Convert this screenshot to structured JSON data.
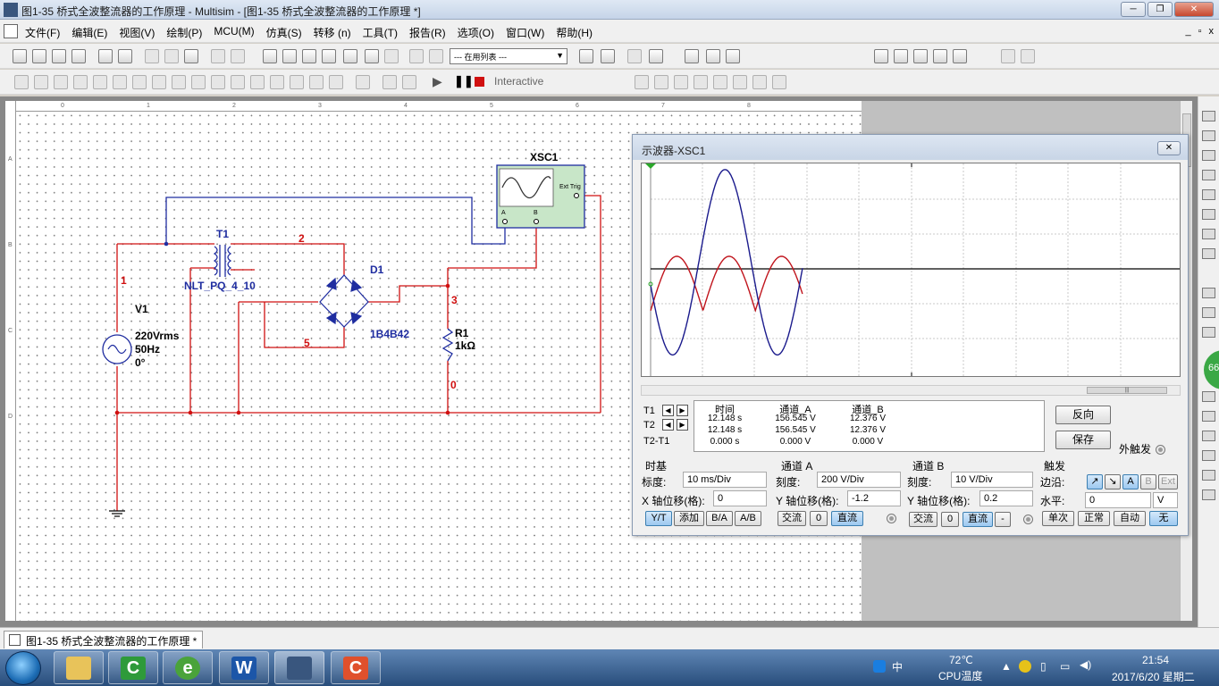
{
  "window": {
    "title": "图1-35  桥式全波整流器的工作原理 - Multisim - [图1-35  桥式全波整流器的工作原理 *]"
  },
  "window_buttons": {
    "minimize": "─",
    "maximize": "❐",
    "close": "✕"
  },
  "menu": [
    "文件(F)",
    "编辑(E)",
    "视图(V)",
    "绘制(P)",
    "MCU(M)",
    "仿真(S)",
    "转移 (n)",
    "工具(T)",
    "报告(R)",
    "选项(O)",
    "窗口(W)",
    "帮助(H)"
  ],
  "mdi_buttons": [
    "_",
    "▫",
    "x"
  ],
  "toolbar": {
    "in_use_list": "--- 在用列表 ---",
    "interactive": "Interactive"
  },
  "rulers": {
    "top": [
      "0",
      "1",
      "2",
      "3",
      "4",
      "5",
      "6",
      "7",
      "8"
    ],
    "left": [
      "A",
      "B",
      "C",
      "D"
    ]
  },
  "circuit": {
    "labels": {
      "xsc1": "XSC1",
      "t1": "T1",
      "t1_model": "NLT_PQ_4_10",
      "d1": "D1",
      "d1_model": "1B4B42",
      "v1": "V1",
      "v1_voltage": "220Vrms",
      "v1_freq": "50Hz",
      "v1_phase": "0°",
      "r1": "R1",
      "r1_value": "1kΩ",
      "net_1": "1",
      "net_2": "2",
      "net_3": "3",
      "net_5": "5",
      "net_0": "0",
      "ext_trig": "Ext Trig",
      "ch_a": "A",
      "ch_b": "B"
    },
    "colors": {
      "wire_red": "#d01010",
      "wire_blue": "#1f2da0",
      "component_blue": "#1f2da0",
      "scope_fill": "#c8e6c8"
    }
  },
  "oscilloscope": {
    "title": "示波器-XSC1",
    "close": "✕",
    "traces": {
      "channel_a_color": "#c0141c",
      "channel_b_color": "#1a1a8c"
    },
    "readout": {
      "headers": [
        "时间",
        "通道_A",
        "通道_B"
      ],
      "rows": [
        {
          "label": "T1",
          "time": "12.148 s",
          "a": "156.545 V",
          "b": "12.376 V"
        },
        {
          "label": "T2",
          "time": "12.148 s",
          "a": "156.545 V",
          "b": "12.376 V"
        },
        {
          "label": "T2-T1",
          "time": "0.000 s",
          "a": "0.000 V",
          "b": "0.000 V"
        }
      ]
    },
    "buttons": {
      "reverse": "反向",
      "save": "保存",
      "ext_trigger": "外触发"
    },
    "timebase": {
      "title": "时基",
      "scale_label": "标度:",
      "scale": "10 ms/Div",
      "xpos_label": "X 轴位移(格):",
      "xpos": "0",
      "modes": [
        "Y/T",
        "添加",
        "B/A",
        "A/B"
      ],
      "active_mode": "Y/T"
    },
    "channel_a": {
      "title": "通道 A",
      "scale_label": "刻度:",
      "scale": "200  V/Div",
      "ypos_label": "Y 轴位移(格):",
      "ypos": "-1.2",
      "coupling": [
        "交流",
        "0",
        "直流"
      ],
      "active_coupling": "直流"
    },
    "channel_b": {
      "title": "通道 B",
      "scale_label": "刻度:",
      "scale": "10  V/Div",
      "ypos_label": "Y 轴位移(格):",
      "ypos": "0.2",
      "coupling": [
        "交流",
        "0",
        "直流",
        "-"
      ],
      "active_coupling": "直流"
    },
    "trigger": {
      "title": "触发",
      "edge_label": "边沿:",
      "edge_buttons": [
        "↗",
        "↘",
        "A",
        "B",
        "Ext"
      ],
      "level_label": "水平:",
      "level": "0",
      "level_unit": "V",
      "modes": [
        "单次",
        "正常",
        "自动",
        "无"
      ],
      "active_mode": "无"
    }
  },
  "doc_tab": "图1-35  桥式全波整流器的工作原理 *",
  "taskbar": {
    "apps": [
      "explorer",
      "camtasia",
      "ie",
      "word",
      "multisim",
      "camtasia-recorder"
    ],
    "word_glyph": "W",
    "camtasia_glyph": "C",
    "ie_glyph": "e",
    "input_method": "中",
    "cpu_temp": "72℃",
    "cpu_label": "CPU温度",
    "time": "21:54",
    "date": "2017/6/20 星期二"
  },
  "side_ball": "66"
}
